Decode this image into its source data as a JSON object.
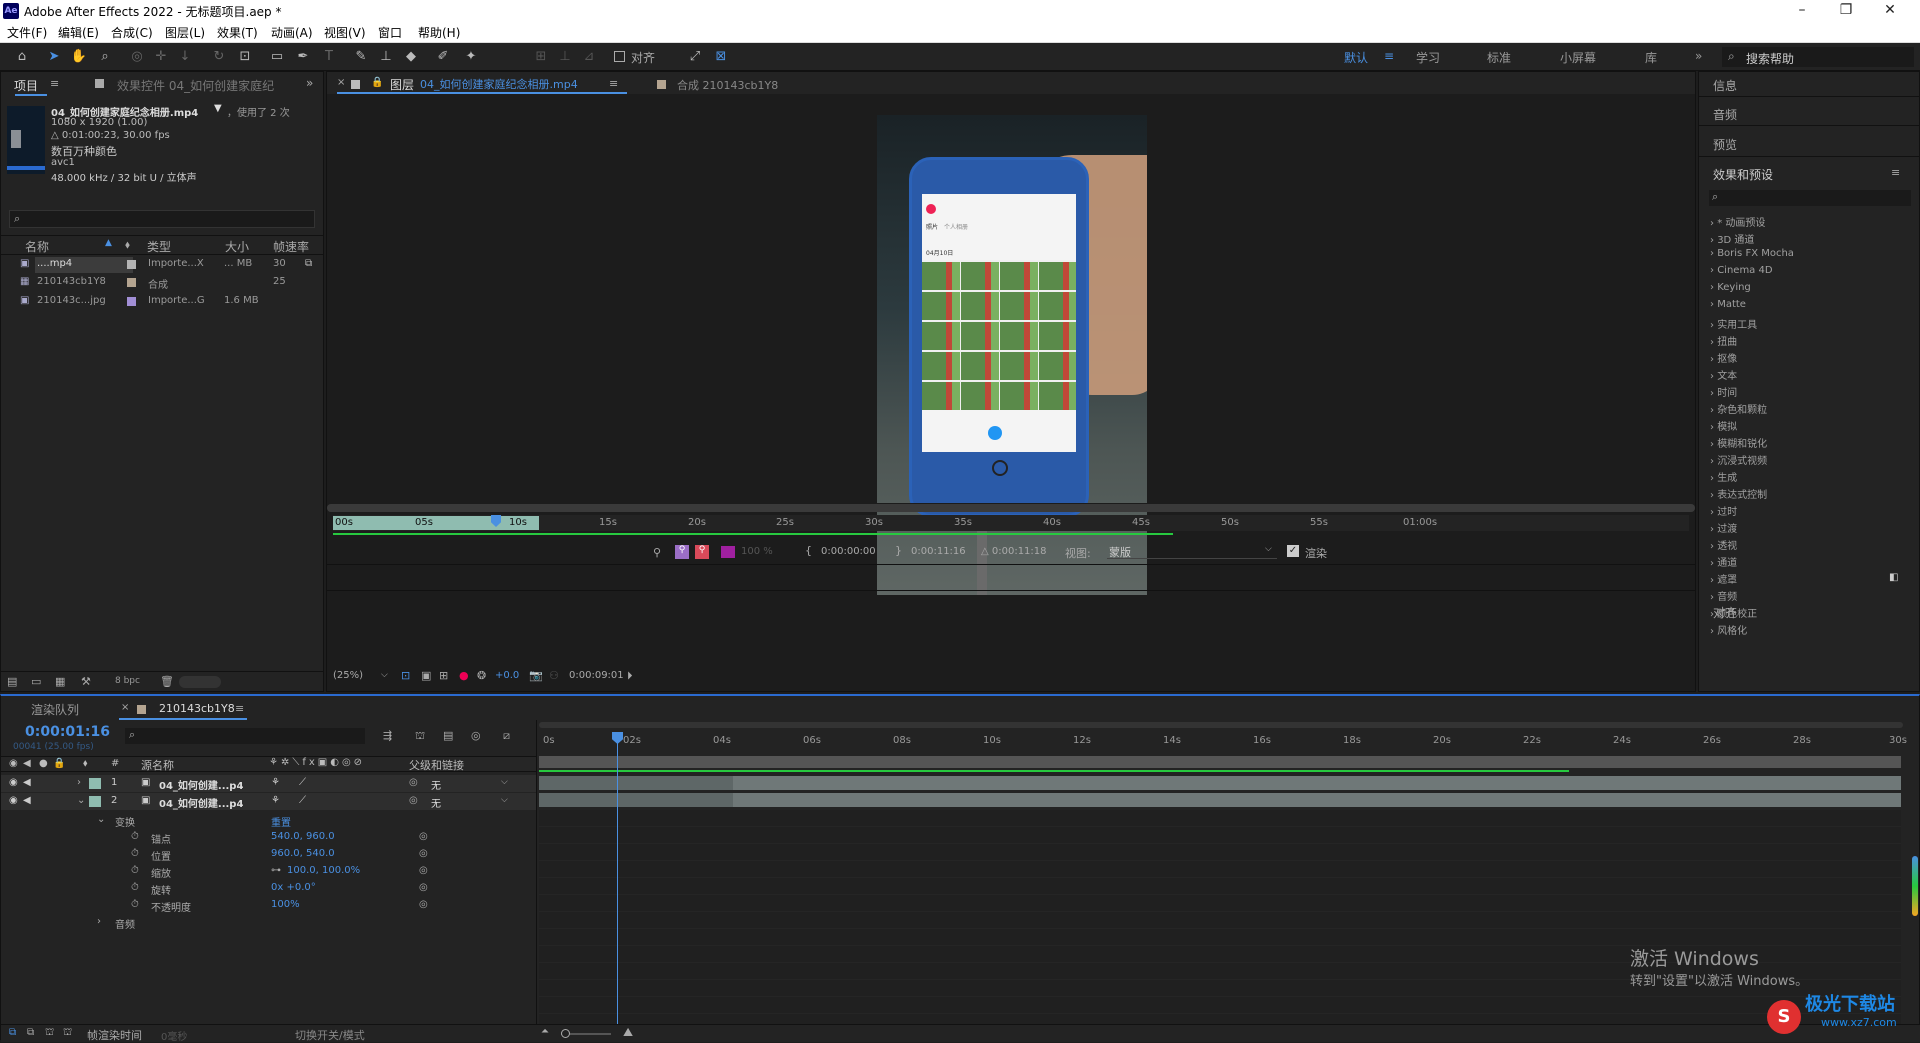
{
  "window": {
    "title": "Adobe After Effects 2022 - 无标题项目.aep *",
    "logo": "Ae"
  },
  "menu": [
    "文件(F)",
    "编辑(E)",
    "合成(C)",
    "图层(L)",
    "效果(T)",
    "动画(A)",
    "视图(V)",
    "窗口",
    "帮助(H)"
  ],
  "toolbar": {
    "align_label": "对齐",
    "workspaces": [
      "默认",
      "学习",
      "标准",
      "小屏幕",
      "库"
    ],
    "search_placeholder": "搜索帮助"
  },
  "project": {
    "tab_project": "项目",
    "tab_effects": "效果控件 04_如何创建家庭纪",
    "asset": {
      "name": "04_如何创建家庭纪念相册.mp4",
      "used": "，使用了 2 次",
      "dims": "1080 x 1920 (1.00)",
      "duration": "△ 0:01:00:23, 30.00 fps",
      "colors": "数百万种颜色",
      "codec": "avc1",
      "audio": "48.000 kHz / 32 bit U / 立体声"
    },
    "columns": [
      "名称",
      "类型",
      "大小",
      "帧速率"
    ],
    "items": [
      {
        "name": "....mp4",
        "type": "Importe...X",
        "size": "... MB",
        "fps": "30",
        "color": "#b4b4b4"
      },
      {
        "name": "210143cb1Y8",
        "type": "合成",
        "size": "",
        "fps": "25",
        "color": "#b4a490"
      },
      {
        "name": "210143c...jpg",
        "type": "Importe...G",
        "size": "1.6 MB",
        "fps": "",
        "color": "#a28fd6"
      }
    ],
    "bpc": "8 bpc"
  },
  "viewer": {
    "tab_layer_prefix": "图层",
    "tab_layer": "04_如何创建家庭纪念相册.mp4",
    "tab_comp": "合成 210143cb1Y8",
    "ruler": [
      "00s",
      "05s",
      "10s",
      "15s",
      "20s",
      "25s",
      "30s",
      "35s",
      "40s",
      "45s",
      "50s",
      "55s",
      "01:00s"
    ],
    "time_in": "0:00:00:00",
    "time_out": "0:00:11:16",
    "duration": "△ 0:00:11:18",
    "view_label": "视图:",
    "view_value": "蒙版",
    "render_label": "渲染",
    "zoom": "(25%)",
    "exposure": "+0.0",
    "current_time": "0:00:09:01",
    "opacity": "100 %",
    "screen": {
      "tabs": [
        "照片",
        "个人相册"
      ],
      "date": "04月10日"
    }
  },
  "right_panel": {
    "items": [
      "信息",
      "音频",
      "预览"
    ],
    "effects_title": "效果和预设",
    "effects": [
      "* 动画预设",
      "3D 通道",
      "Boris FX Mocha",
      "Cinema 4D",
      "Keying",
      "Matte",
      "实用工具",
      "扭曲",
      "抠像",
      "文本",
      "时间",
      "杂色和颗粒",
      "模拟",
      "模糊和锐化",
      "沉浸式视频",
      "生成",
      "表达式控制",
      "过时",
      "过渡",
      "透视",
      "通道",
      "遮罩",
      "音频",
      "颜色校正",
      "风格化"
    ],
    "align": "对齐"
  },
  "timeline": {
    "tab_render": "渲染队列",
    "tab_comp": "210143cb1Y8",
    "time": "0:00:01:16",
    "frames": "00041 (25.00 fps)",
    "col_name": "源名称",
    "col_parent": "父级和链接",
    "layers": [
      {
        "num": "1",
        "name": "04_如何创建...p4",
        "parent": "无"
      },
      {
        "num": "2",
        "name": "04_如何创建...p4",
        "parent": "无"
      }
    ],
    "transform": "变换",
    "reset": "重置",
    "props": [
      {
        "name": "锚点",
        "value": "540.0, 960.0"
      },
      {
        "name": "位置",
        "value": "960.0, 540.0"
      },
      {
        "name": "缩放",
        "value": "100.0, 100.0%"
      },
      {
        "name": "旋转",
        "value": "0x +0.0°"
      },
      {
        "name": "不透明度",
        "value": "100%"
      }
    ],
    "audio": "音频",
    "ruler": [
      "0s",
      "02s",
      "04s",
      "06s",
      "08s",
      "10s",
      "12s",
      "14s",
      "16s",
      "18s",
      "20s",
      "22s",
      "24s",
      "26s",
      "28s",
      "30s"
    ],
    "footer_render": "帧渲染时间",
    "footer_ms": "0毫秒",
    "footer_toggle": "切换开关/模式"
  },
  "watermark": {
    "line1": "激活 Windows",
    "line2": "转到\"设置\"以激活 Windows。",
    "brand": "极光下载站",
    "url": "www.xz7.com"
  }
}
